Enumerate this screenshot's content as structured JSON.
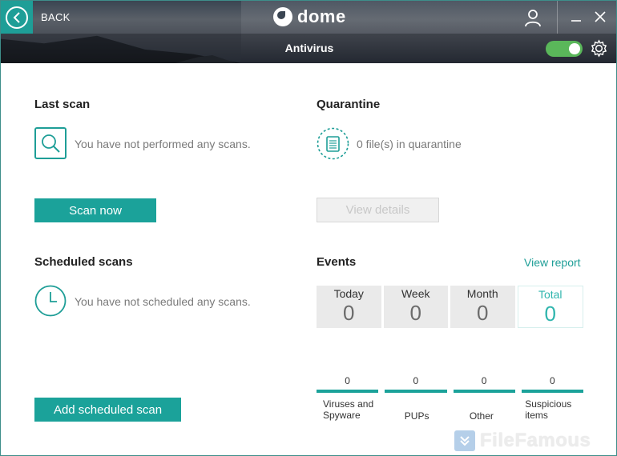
{
  "header": {
    "back_label": "BACK",
    "logo_text": "dome",
    "section_title": "Antivirus",
    "toggle_on": true
  },
  "last_scan": {
    "title": "Last scan",
    "message": "You have not performed any scans.",
    "button": "Scan now"
  },
  "quarantine": {
    "title": "Quarantine",
    "message": "0 file(s) in quarantine",
    "button": "View details"
  },
  "scheduled": {
    "title": "Scheduled scans",
    "message": "You have not scheduled any scans.",
    "button": "Add scheduled scan"
  },
  "events": {
    "title": "Events",
    "link": "View report",
    "periods": [
      {
        "label": "Today",
        "value": "0"
      },
      {
        "label": "Week",
        "value": "0"
      },
      {
        "label": "Month",
        "value": "0"
      },
      {
        "label": "Total",
        "value": "0"
      }
    ],
    "categories": [
      {
        "count": "0",
        "label": "Viruses and Spyware"
      },
      {
        "count": "0",
        "label": "PUPs"
      },
      {
        "count": "0",
        "label": "Other"
      },
      {
        "count": "0",
        "label": "Suspicious items"
      }
    ]
  },
  "watermark": "FileFamous",
  "colors": {
    "accent": "#1ba29a",
    "toggle": "#5ab75a"
  },
  "icons": [
    "back-arrow-icon",
    "user-icon",
    "minimize-icon",
    "close-icon",
    "gear-icon",
    "search-icon",
    "clock-icon",
    "quarantine-icon"
  ]
}
